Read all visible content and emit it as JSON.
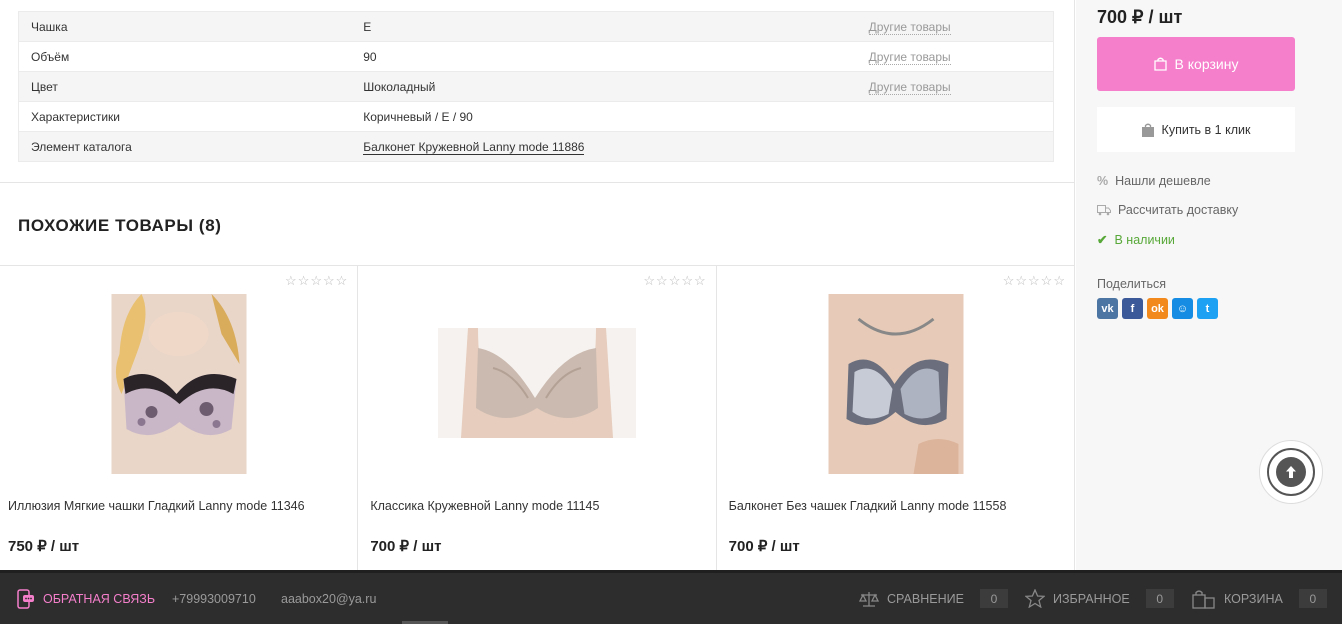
{
  "properties": [
    {
      "label": "Чашка",
      "value": "E",
      "other": "Другие товары"
    },
    {
      "label": "Объём",
      "value": "90",
      "other": "Другие товары"
    },
    {
      "label": "Цвет",
      "value": "Шоколадный",
      "other": "Другие товары"
    },
    {
      "label": "Характеристики",
      "value": "Коричневый / E / 90",
      "other": ""
    },
    {
      "label": "Элемент каталога",
      "value": "Балконет Кружевной Lanny mode 11886",
      "other": ""
    }
  ],
  "similar": {
    "title": "ПОХОЖИЕ ТОВАРЫ (8)",
    "products": [
      {
        "name": "Иллюзия Мягкие чашки Гладкий Lanny mode 11346",
        "price": "750 ₽ / шт"
      },
      {
        "name": "Классика Кружевной Lanny mode 11145",
        "price": "700 ₽ / шт"
      },
      {
        "name": "Балконет Без чашек Гладкий Lanny mode 11558",
        "price": "700 ₽ / шт"
      }
    ]
  },
  "sidebar": {
    "price": "700 ₽ / шт",
    "cart_button": "В корзину",
    "one_click": "Купить в 1 клик",
    "cheaper": "Нашли дешевле",
    "delivery": "Рассчитать доставку",
    "stock": "В наличии",
    "share": "Поделиться",
    "socials": [
      "vk",
      "fb",
      "ok",
      "mm",
      "tw"
    ]
  },
  "footer": {
    "feedback": "ОБРАТНАЯ СВЯЗЬ",
    "phone": "+79993009710",
    "email": "aaabox20@ya.ru",
    "compare": "СРАВНЕНИЕ",
    "compare_count": "0",
    "favorites": "ИЗБРАННОЕ",
    "favorites_count": "0",
    "cart": "КОРЗИНА",
    "cart_count": "0"
  },
  "colors": {
    "accent": "#f57fcb",
    "stock": "#57a838",
    "footer_bg": "#2d2d2d"
  }
}
